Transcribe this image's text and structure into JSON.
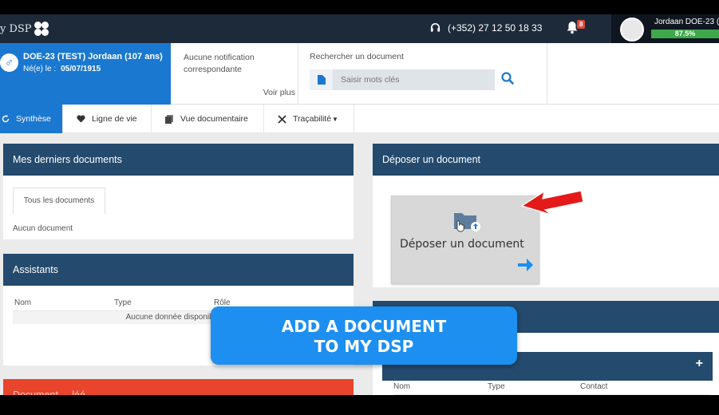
{
  "topbar": {
    "logo_text": "y DSP",
    "phone": "(+352) 27 12 50 18 33",
    "notification_count": "8",
    "user_name": "Jordaan DOE-23 (",
    "progress": "87.5%",
    "progress_value": 0.875
  },
  "patient": {
    "name": "DOE-23 (TEST) Jordaan (107 ans)",
    "dob_label": "Né(e) le :",
    "dob_value": "05/07/1915"
  },
  "notifications": {
    "text": "Aucune notification correspondante",
    "more_link": "Voir plus"
  },
  "search": {
    "label": "Rechercher un document",
    "placeholder": "Saisir mots clés"
  },
  "tabs": [
    {
      "label": "Synthèse"
    },
    {
      "label": "Ligne de vie"
    },
    {
      "label": "Vue documentaire"
    },
    {
      "label": "Traçabilité"
    }
  ],
  "recent_docs": {
    "title": "Mes derniers documents",
    "filter_tab": "Tous les documents",
    "empty_text": "Aucun document"
  },
  "assistants": {
    "title": "Assistants",
    "columns": [
      "Nom",
      "Type",
      "Rôle"
    ],
    "empty_text": "Aucune donnée disponible da"
  },
  "third_panel": {
    "title": "Document ... léé"
  },
  "deposit": {
    "title": "Déposer un document",
    "card_label": "Déposer un document"
  },
  "contacts": {
    "columns": [
      "Nom",
      "Type",
      "Contact"
    ]
  },
  "cta": {
    "line1": "ADD A DOCUMENT",
    "line2": "TO MY DSP"
  },
  "colors": {
    "topbar": "#1d2a3a",
    "brand_blue": "#1a78d0",
    "panel_header": "#244a6d",
    "cta": "#1c8ff0",
    "progress": "#3ea84a",
    "arrow": "#e41a1a"
  }
}
